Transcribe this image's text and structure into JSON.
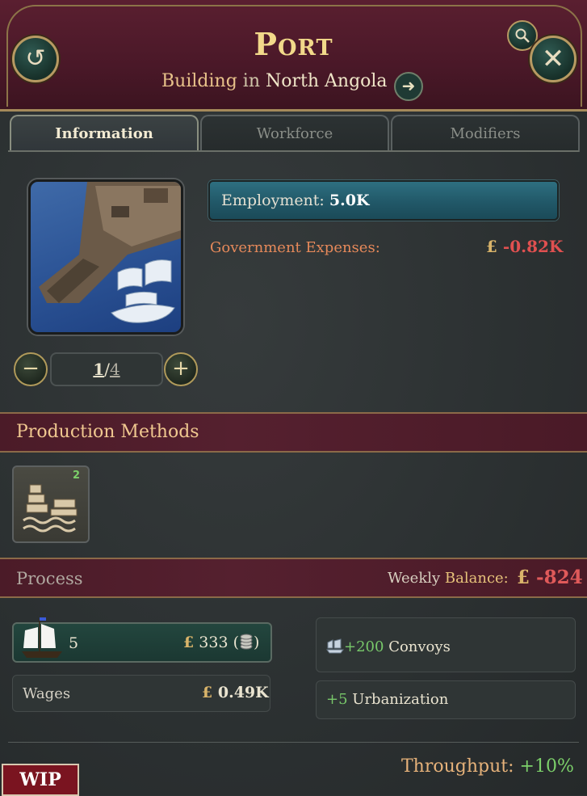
{
  "header": {
    "title": "Port",
    "subtitle_type": "Building",
    "subtitle_in": "in",
    "subtitle_location": "North Angola"
  },
  "icons": {
    "back": "undo-arrow-icon",
    "search": "magnifier-icon",
    "close": "close-icon",
    "goto": "arrow-right-icon",
    "minus": "minus-icon",
    "plus": "plus-icon",
    "ship": "clipper-ship-icon",
    "coin": "coin-stack-icon",
    "convoy": "convoy-icon",
    "process_arrow": "arrow-right-icon"
  },
  "tabs": [
    {
      "label": "Information",
      "active": true
    },
    {
      "label": "Workforce",
      "active": false
    },
    {
      "label": "Modifiers",
      "active": false
    }
  ],
  "levels": {
    "current": "1",
    "max": "4",
    "separator": "/"
  },
  "employment": {
    "label": "Employment:",
    "value": "5.0K",
    "fill_fraction": 1.0
  },
  "government_expenses": {
    "label": "Government Expenses:",
    "currency": "£",
    "value": "-0.82K"
  },
  "production_methods": {
    "title": "Production Methods",
    "badge": "2"
  },
  "process": {
    "title": "Process",
    "weekly_label": "Weekly",
    "balance_label": "Balance:",
    "currency": "£",
    "weekly_value": "-824"
  },
  "inputs": {
    "ship_qty": "5",
    "currency": "£",
    "ship_cost": "333",
    "wages_label": "Wages",
    "wages_value": "0.49K"
  },
  "outputs": {
    "convoys_value": "+200",
    "convoys_label": "Convoys",
    "urbanization_value": "+5",
    "urbanization_label": "Urbanization"
  },
  "throughput": {
    "label": "Throughput:",
    "value": "+10%"
  },
  "wip_label": "WIP",
  "colors": {
    "header_bg": "#4a1828",
    "gold": "#f2d98a",
    "negative": "#e05050",
    "positive": "#78c86a",
    "employment_bar": "#215868"
  }
}
